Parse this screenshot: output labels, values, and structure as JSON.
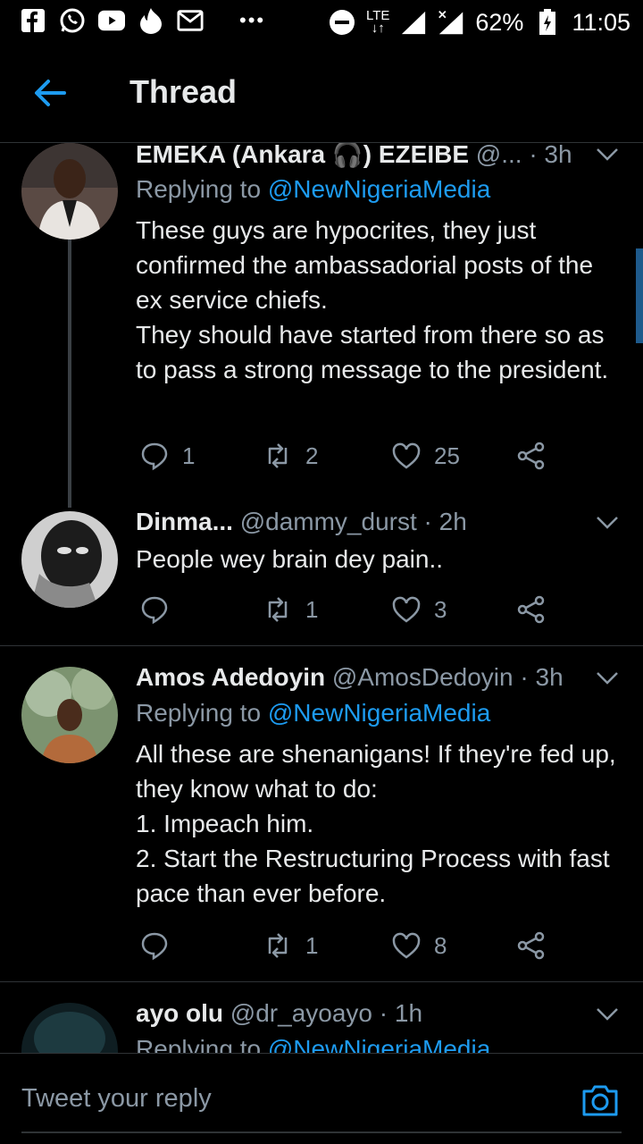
{
  "status_bar": {
    "network": "LTE",
    "battery": "62%",
    "time": "11:05",
    "left_icons": [
      "facebook-icon",
      "whatsapp-icon",
      "youtube-icon",
      "fire-icon",
      "gmail-icon"
    ]
  },
  "header": {
    "title": "Thread"
  },
  "tweets": [
    {
      "name": "EMEKA (Ankara 🎧) EZEIBE",
      "handle": "@...",
      "time": "· 3h",
      "replying_prefix": "Replying to ",
      "replying_to": "@NewNigeriaMedia",
      "body": "These guys are hypocrites, they just confirmed the ambassadorial posts of the ex service chiefs.\nThey should have started from there so as to pass a strong message to the president.",
      "replies": "1",
      "retweets": "2",
      "likes": "25"
    },
    {
      "name": "Dinma...",
      "handle": "@dammy_durst",
      "time": "· 2h",
      "body": "People wey brain dey pain..",
      "replies": "",
      "retweets": "1",
      "likes": "3"
    },
    {
      "name": "Amos Adedoyin",
      "handle": "@AmosDedoyin",
      "time": "· 3h",
      "replying_prefix": "Replying to ",
      "replying_to": "@NewNigeriaMedia",
      "body": "All these are shenanigans! If they're fed up, they know what to do:\n1. Impeach him.\n2. Start the Restructuring Process with fast pace than ever before.",
      "replies": "",
      "retweets": "1",
      "likes": "8"
    },
    {
      "name": "ayo olu",
      "handle": "@dr_ayoayo",
      "time": "· 1h",
      "replying_prefix": "Replying to ",
      "replying_to": "@NewNigeriaMedia"
    }
  ],
  "composer": {
    "placeholder": "Tweet your reply"
  },
  "colors": {
    "accent": "#1d9bf0",
    "muted": "#8b98a5",
    "background": "#000000"
  }
}
